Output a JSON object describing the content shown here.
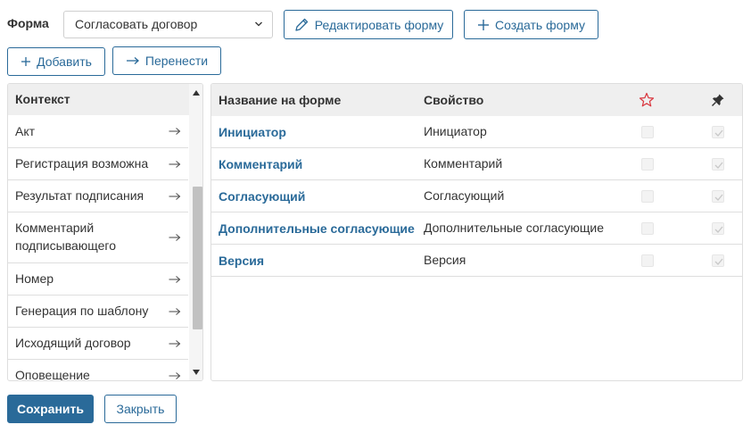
{
  "form_bar": {
    "label": "Форма",
    "selected_form": "Согласовать договор",
    "edit_label": "Редактировать форму",
    "create_label": "Создать форму"
  },
  "actions": {
    "add_label": "Добавить",
    "move_label": "Перенести"
  },
  "context": {
    "header": "Контекст",
    "items": [
      "Акт",
      "Регистрация возможна",
      "Результат подписания",
      "Комментарий подписывающего",
      "Номер",
      "Генерация по шаблону",
      "Исходящий договор",
      "Оповещение"
    ]
  },
  "table": {
    "columns": {
      "name": "Название на форме",
      "property": "Свойство",
      "required_icon": "star-icon",
      "readonly_icon": "pin-icon"
    },
    "rows": [
      {
        "name": "Инициатор",
        "property": "Инициатор",
        "required": false,
        "readonly": true
      },
      {
        "name": "Комментарий",
        "property": "Комментарий",
        "required": false,
        "readonly": true
      },
      {
        "name": "Согласующий",
        "property": "Согласующий",
        "required": false,
        "readonly": true
      },
      {
        "name": "Дополнительные согласующие",
        "property": "Дополнительные согласующие",
        "required": false,
        "readonly": true
      },
      {
        "name": "Версия",
        "property": "Версия",
        "required": false,
        "readonly": true
      }
    ]
  },
  "footer": {
    "save_label": "Сохранить",
    "close_label": "Закрыть"
  },
  "colors": {
    "accent": "#2a6a99",
    "star": "#d9363e",
    "header_bg": "#efefef",
    "border": "#dedede"
  }
}
